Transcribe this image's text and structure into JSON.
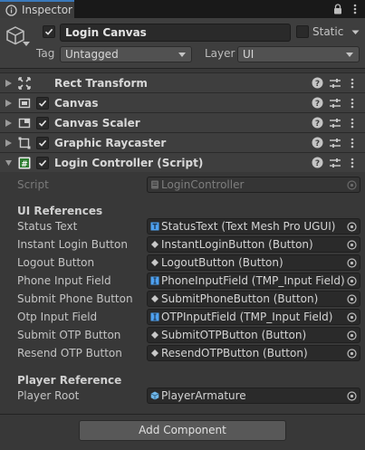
{
  "tab": {
    "title": "Inspector"
  },
  "gameobject": {
    "name": "Login Canvas",
    "active": true,
    "static_label": "Static",
    "tag_label": "Tag",
    "tag_value": "Untagged",
    "layer_label": "Layer",
    "layer_value": "UI"
  },
  "components": [
    {
      "name": "Rect Transform",
      "has_checkbox": false,
      "icon": "rect-transform-icon"
    },
    {
      "name": "Canvas",
      "has_checkbox": true,
      "icon": "canvas-icon"
    },
    {
      "name": "Canvas Scaler",
      "has_checkbox": true,
      "icon": "canvas-scaler-icon"
    },
    {
      "name": "Graphic Raycaster",
      "has_checkbox": true,
      "icon": "graphic-raycaster-icon"
    },
    {
      "name": "Login Controller (Script)",
      "has_checkbox": true,
      "icon": "csharp-script-icon",
      "expanded": true
    }
  ],
  "script": {
    "label": "Script",
    "value": "LoginController"
  },
  "ui_references": {
    "header": "UI References",
    "fields": [
      {
        "label": "Status Text",
        "value": "StatusText (Text Mesh Pro UGUI)",
        "icon": "text-icon"
      },
      {
        "label": "Instant Login Button",
        "value": "InstantLoginButton (Button)",
        "icon": "button-icon"
      },
      {
        "label": "Logout Button",
        "value": "LogoutButton (Button)",
        "icon": "button-icon"
      },
      {
        "label": "Phone Input Field",
        "value": "PhoneInputField (TMP_Input Field)",
        "icon": "input-field-icon"
      },
      {
        "label": "Submit Phone Button",
        "value": "SubmitPhoneButton (Button)",
        "icon": "button-icon"
      },
      {
        "label": "Otp Input Field",
        "value": "OTPInputField (TMP_Input Field)",
        "icon": "input-field-icon"
      },
      {
        "label": "Submit OTP Button",
        "value": "SubmitOTPButton (Button)",
        "icon": "button-icon"
      },
      {
        "label": "Resend OTP Button",
        "value": "ResendOTPButton (Button)",
        "icon": "button-icon"
      }
    ]
  },
  "player_reference": {
    "header": "Player Reference",
    "fields": [
      {
        "label": "Player Root",
        "value": "PlayerArmature",
        "icon": "prefab-icon"
      }
    ]
  },
  "add_component_label": "Add Component",
  "colors": {
    "accent": "#3a79bb",
    "panel": "#383838",
    "field": "#2a2a2a",
    "text_blue_icon": "#4ea1f0"
  }
}
